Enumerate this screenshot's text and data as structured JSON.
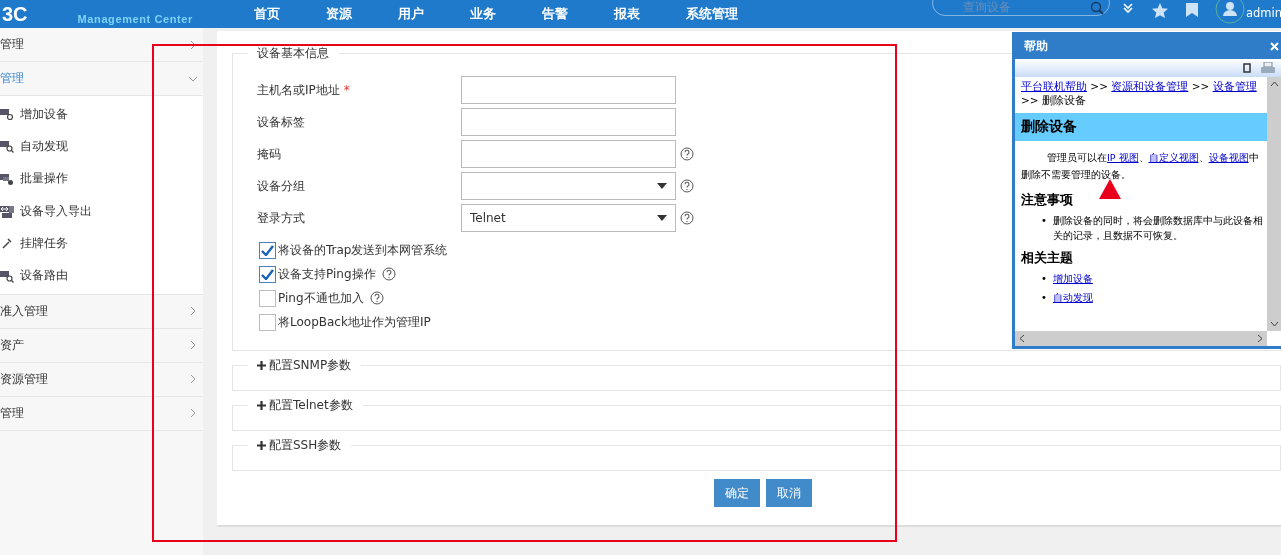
{
  "header": {
    "logo": "3C",
    "logo_subtitle": "Management Center",
    "nav": [
      {
        "label": "首页"
      },
      {
        "label": "资源"
      },
      {
        "label": "用户"
      },
      {
        "label": "业务"
      },
      {
        "label": "告警"
      },
      {
        "label": "报表"
      },
      {
        "label": "系统管理"
      }
    ],
    "search": {
      "placeholder": "查询设备"
    },
    "user": "admin"
  },
  "sidebar": {
    "items": [
      {
        "label": "管理",
        "expanded": false,
        "selected": false
      },
      {
        "label": "管理",
        "expanded": true,
        "selected": true,
        "children": [
          {
            "label": "增加设备",
            "kind": "add"
          },
          {
            "label": "自动发现",
            "kind": "discover"
          },
          {
            "label": "批量操作",
            "kind": "batch"
          },
          {
            "label": "设备导入导出",
            "kind": "import"
          },
          {
            "label": "挂牌任务",
            "kind": "tag"
          },
          {
            "label": "设备路由",
            "kind": "route"
          }
        ]
      },
      {
        "label": "准入管理",
        "expanded": false,
        "selected": false
      },
      {
        "label": "资产",
        "expanded": false,
        "selected": false
      },
      {
        "label": "资源管理",
        "expanded": false,
        "selected": false
      },
      {
        "label": "管理",
        "expanded": false,
        "selected": false
      }
    ]
  },
  "form": {
    "section_title": "设备基本信息",
    "fields": [
      {
        "label": "主机名或IP地址",
        "required_mark": "*",
        "kind": "text",
        "help": false
      },
      {
        "label": "设备标签",
        "kind": "text",
        "help": false
      },
      {
        "label": "掩码",
        "kind": "text",
        "help": true
      },
      {
        "label": "设备分组",
        "kind": "select",
        "help": true
      },
      {
        "label": "登录方式",
        "kind": "select",
        "value": "Telnet",
        "help": true
      }
    ],
    "options": [
      {
        "label": "将设备的Trap发送到本网管系统",
        "checked": true,
        "help": false
      },
      {
        "label": "设备支持Ping操作",
        "checked": true,
        "help": true
      },
      {
        "label": "Ping不通也加入",
        "checked": false,
        "help": true
      },
      {
        "label": "将LoopBack地址作为管理IP",
        "checked": false,
        "help": false
      }
    ],
    "sections": [
      {
        "label": "配置SNMP参数",
        "expanded": false
      },
      {
        "label": "配置Telnet参数",
        "expanded": false
      },
      {
        "label": "配置SSH参数",
        "expanded": false
      }
    ],
    "buttons": [
      "确定",
      "取消"
    ]
  },
  "help_window": {
    "title": "帮助",
    "breadcrumb": [
      {
        "kind": "link",
        "text": "平台联机帮助"
      },
      {
        "kind": "text",
        "text": ">>"
      },
      {
        "kind": "link",
        "text": "资源和设备管理"
      },
      {
        "kind": "text",
        "text": ">>"
      },
      {
        "kind": "link",
        "text": "设备管理"
      },
      {
        "kind": "text",
        "text": ">>"
      },
      {
        "kind": "text",
        "text": "删除设备"
      }
    ],
    "heading": "删除设备",
    "paragraph": [
      {
        "kind": "text",
        "text": "管理员可以在"
      },
      {
        "kind": "link",
        "text": "IP 视图"
      },
      {
        "kind": "text",
        "text": "、"
      },
      {
        "kind": "link",
        "text": "自定义视图"
      },
      {
        "kind": "text",
        "text": "、"
      },
      {
        "kind": "link",
        "text": "设备视图"
      },
      {
        "kind": "text",
        "text": "中删除不需要管理的设备。"
      }
    ],
    "notes_title": "注意事项",
    "notes": [
      {
        "bullet": "•",
        "text": "删除设备的同时，将会删除数据库中与此设备相关的记录，且数据不可恢复。"
      }
    ],
    "related_title": "相关主题",
    "related": [
      {
        "bullet": "•",
        "text": "增加设备"
      },
      {
        "bullet": "•",
        "text": "自动发现"
      }
    ],
    "marker": {
      "kind": "arrow",
      "color": "#e8001c"
    }
  },
  "annotation": {
    "kind": "rectangle",
    "color": "#e8001c"
  }
}
